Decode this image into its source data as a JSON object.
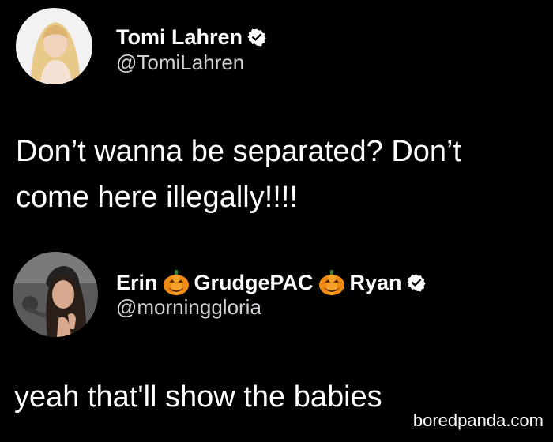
{
  "colors": {
    "background": "#000000",
    "primary_text": "#ffffff",
    "secondary_text": "#cfd3d7",
    "verified_badge": "#ffffff"
  },
  "original_tweet": {
    "display_name": "Tomi Lahren",
    "handle": "@TomiLahren",
    "verified": true,
    "avatar_icon": "profile-photo",
    "text": "Don’t wanna be separated? Don’t come here illegally!!!!"
  },
  "reply_tweet": {
    "display_name_parts": [
      "Erin",
      "GrudgePAC",
      "Ryan"
    ],
    "name_emoji_icon": "jack-o-lantern-icon",
    "handle": "@morninggloria",
    "verified": true,
    "avatar_icon": "profile-photo",
    "text": "yeah that'll show the babies"
  },
  "watermark": "boredpanda.com"
}
